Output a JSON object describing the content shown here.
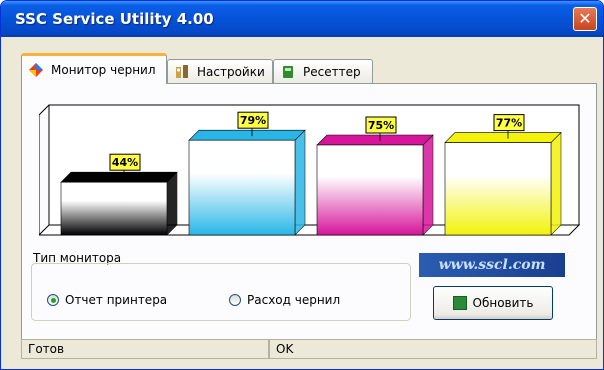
{
  "window": {
    "title": "SSC Service Utility 4.00",
    "close_label": "✕"
  },
  "tabs": [
    {
      "label": "Монитор чернил",
      "icon": "ink-monitor-icon",
      "active": true
    },
    {
      "label": "Настройки",
      "icon": "settings-icon",
      "active": false
    },
    {
      "label": "Ресеттер",
      "icon": "resetter-icon",
      "active": false
    }
  ],
  "chart_data": {
    "type": "bar",
    "categories": [
      "Black",
      "Cyan",
      "Magenta",
      "Yellow"
    ],
    "values": [
      44,
      79,
      75,
      77
    ],
    "labels": [
      "44%",
      "79%",
      "75%",
      "77%"
    ],
    "colors": [
      "#000000",
      "#29b6e6",
      "#d6159a",
      "#f2f20a"
    ],
    "ylim": [
      0,
      100
    ]
  },
  "monitor": {
    "group_label": "Тип монитора",
    "option_printer": "Отчет принтера",
    "option_ink": "Расход чернил",
    "selected": "printer"
  },
  "logo_text": "www.sscl.com",
  "refresh_label": "Обновить",
  "status": {
    "left": "Готов",
    "right": "OK"
  }
}
